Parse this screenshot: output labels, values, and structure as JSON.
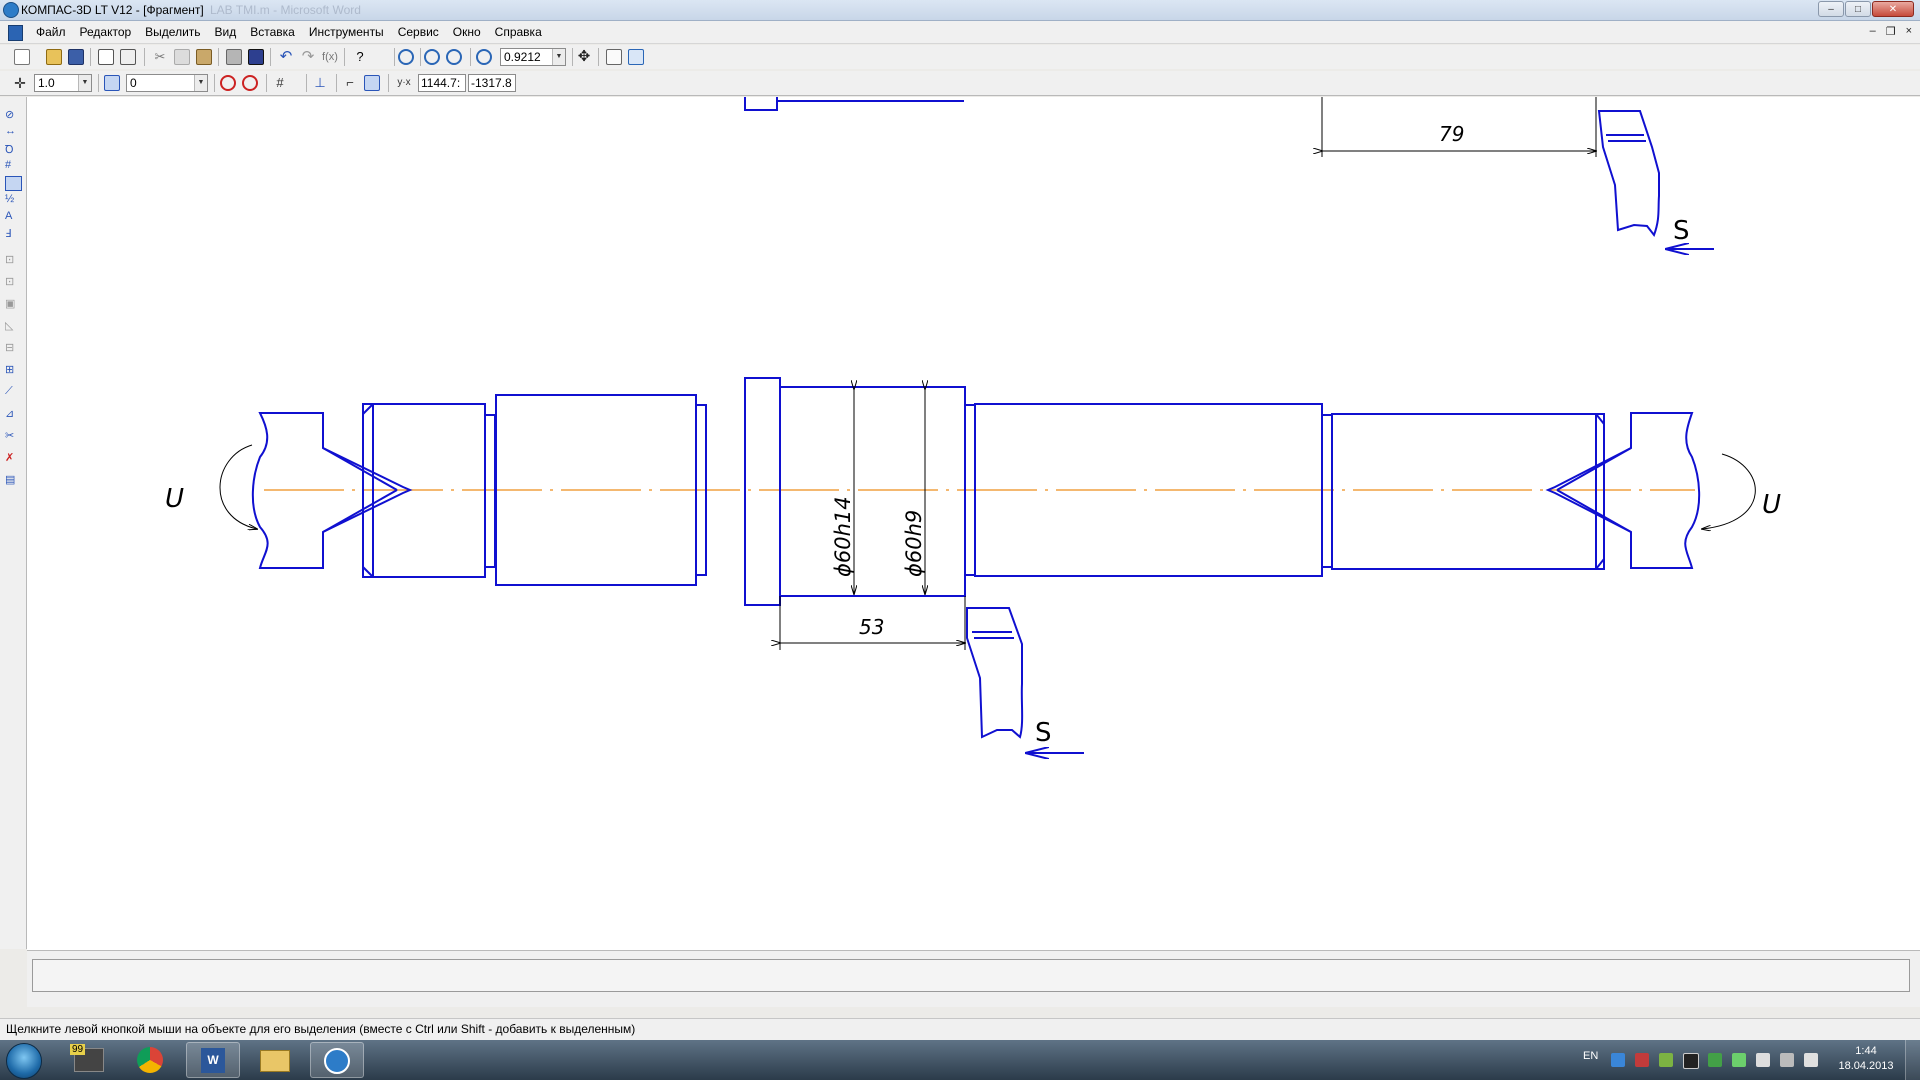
{
  "window": {
    "title": "КОМПАС-3D LT V12 - [Фрагмент]",
    "ghost_title": "LAB TMI.m - Microsoft Word",
    "minimize": "–",
    "maximize": "□",
    "close": "✕"
  },
  "menu": {
    "items": [
      "Файл",
      "Редактор",
      "Выделить",
      "Вид",
      "Вставка",
      "Инструменты",
      "Сервис",
      "Окно",
      "Справка"
    ],
    "mdi_minimize": "–",
    "mdi_restore": "❐",
    "mdi_close": "×"
  },
  "toolbar": {
    "zoom_value": "0.9212",
    "step_value": "1.0",
    "layer_value": "0",
    "coord_x": "1144.7:",
    "coord_y": "-1317.8"
  },
  "drawing": {
    "dimension_top": "79",
    "dimension_bottom": "53",
    "diameter_h14": "ϕ60h14",
    "diameter_h9": "ϕ60h9",
    "feed_label_top": "S",
    "feed_label_bottom": "S",
    "rotation_left": "U",
    "rotation_right": "U",
    "line_color": "#1010d0",
    "axis_color": "#f0a040"
  },
  "status": {
    "message": "Щелкните левой кнопкой мыши на объекте для его выделения (вместе с Ctrl или Shift - добавить к выделенным)"
  },
  "taskbar": {
    "language": "EN",
    "time": "1:44",
    "date": "18.04.2013",
    "badge": "99"
  }
}
